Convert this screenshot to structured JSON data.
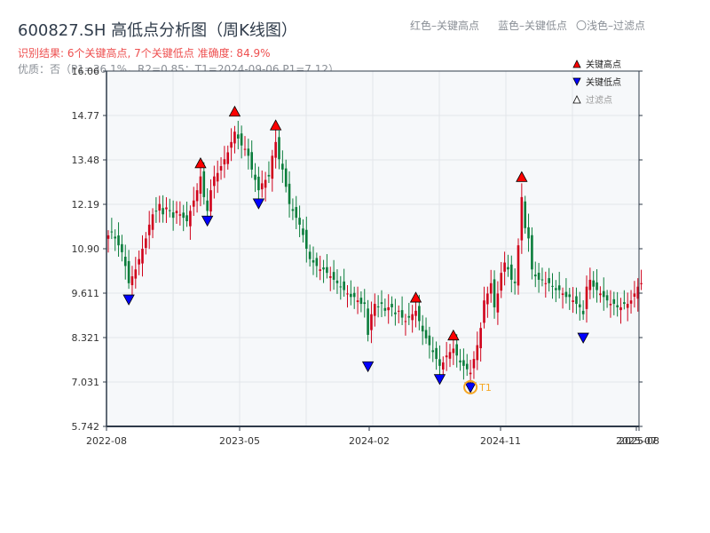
{
  "header": {
    "title": "600827.SH 高低点分析图（周K线图）",
    "result": "识别结果: 6个关键高点, 7个关键低点  准确度: 84.9%",
    "quality": "优质：否（P1=36.1%，R2=0.85；T1=2024-09-06 P1=7.12）",
    "legend_top": [
      "红色–关键高点",
      "蓝色–关键低点",
      "〇浅色–过滤点"
    ]
  },
  "colors": {
    "up": "#d0021b",
    "down": "#0a7d3b",
    "high_marker": "#ff0000",
    "low_marker": "#0000ff",
    "t1": "#f5a623",
    "plot_bg": "#f6f8fa"
  },
  "chart_data": {
    "type": "candlestick",
    "title": "600827.SH 高低点分析图（周K线图）",
    "ylim": [
      5.742,
      16.06
    ],
    "yticks": [
      "16.06",
      "14.77",
      "13.48",
      "12.19",
      "10.90",
      "9.611",
      "8.321",
      "7.031",
      "5.742"
    ],
    "xticks": [
      "2022-08",
      "2023-05",
      "2024-02",
      "2024-11",
      "2025-07",
      "2025-08"
    ],
    "grid": true,
    "legend_placement": "top-right",
    "legend": [
      {
        "label": "关键高点",
        "marker": "triangle-up-red"
      },
      {
        "label": "关键低点",
        "marker": "triangle-down-blue"
      },
      {
        "label": "过滤点",
        "marker": "triangle-up-hollow"
      }
    ],
    "weekly_close": [
      11.29,
      11.4,
      11.2,
      11.0,
      10.8,
      10.4,
      9.9,
      10.1,
      10.3,
      10.6,
      10.9,
      11.2,
      11.6,
      11.9,
      12.0,
      12.2,
      11.9,
      12.1,
      12.0,
      11.8,
      12.0,
      11.9,
      11.8,
      11.7,
      12.0,
      12.3,
      12.6,
      13.0,
      12.4,
      12.0,
      12.6,
      13.0,
      13.1,
      13.3,
      13.5,
      13.7,
      14.0,
      14.3,
      14.1,
      13.9,
      13.8,
      13.6,
      13.2,
      12.9,
      12.6,
      12.8,
      12.9,
      13.0,
      13.6,
      14.0,
      13.5,
      13.2,
      12.7,
      12.2,
      12.0,
      11.8,
      11.6,
      11.3,
      10.9,
      10.6,
      10.5,
      10.4,
      10.3,
      10.3,
      10.2,
      10.1,
      10.0,
      9.9,
      9.8,
      9.7,
      9.6,
      9.5,
      9.5,
      9.4,
      9.3,
      9.3,
      8.4,
      9.0,
      9.3,
      9.2,
      9.3,
      9.1,
      9.2,
      9.2,
      9.0,
      9.1,
      8.9,
      8.8,
      8.9,
      9.0,
      9.1,
      8.8,
      8.5,
      8.3,
      8.1,
      7.9,
      7.7,
      7.5,
      7.6,
      7.8,
      7.9,
      8.0,
      7.8,
      7.6,
      7.5,
      7.4,
      7.3,
      7.7,
      8.1,
      8.6,
      9.4,
      9.6,
      9.9,
      9.2,
      9.6,
      10.2,
      10.5,
      10.3,
      10.0,
      9.9,
      11.0,
      12.4,
      11.5,
      11.2,
      10.3,
      10.1,
      10.0,
      10.0,
      9.9,
      9.9,
      9.8,
      9.7,
      9.7,
      9.6,
      9.5,
      9.5,
      9.4,
      9.3,
      9.2,
      9.0,
      9.8,
      10.0,
      9.8,
      9.7,
      9.6,
      9.5,
      9.4,
      9.3,
      9.3,
      9.2,
      9.2,
      9.3,
      9.3,
      9.4,
      9.6,
      9.8,
      9.9
    ],
    "key_highs": [
      {
        "week": 27,
        "price": 13.2
      },
      {
        "week": 37,
        "price": 14.7
      },
      {
        "week": 49,
        "price": 14.3
      },
      {
        "week": 90,
        "price": 9.3
      },
      {
        "week": 101,
        "price": 8.2
      },
      {
        "week": 121,
        "price": 12.8
      }
    ],
    "key_lows": [
      {
        "week": 6,
        "price": 9.61
      },
      {
        "week": 29,
        "price": 11.9
      },
      {
        "week": 44,
        "price": 12.4
      },
      {
        "week": 76,
        "price": 7.67
      },
      {
        "week": 97,
        "price": 7.3
      },
      {
        "week": 106,
        "price": 7.06
      },
      {
        "week": 139,
        "price": 8.5
      }
    ],
    "annotation": {
      "label": "T1",
      "week": 106,
      "price": 7.06
    }
  }
}
